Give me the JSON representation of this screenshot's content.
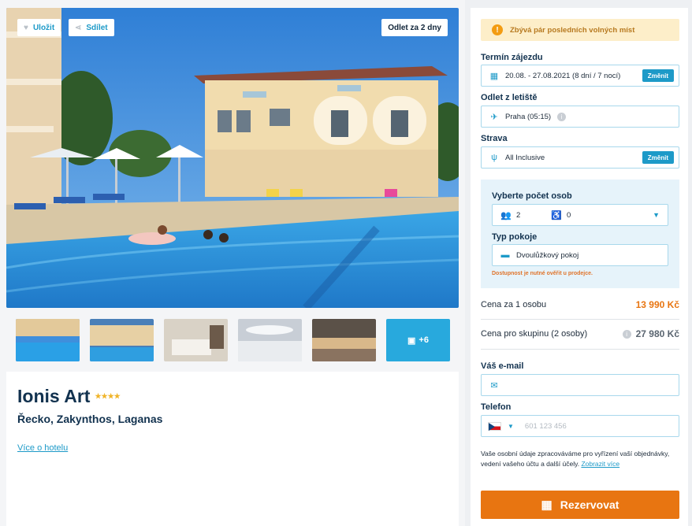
{
  "hero": {
    "save_label": "Uložit",
    "share_label": "Sdílet",
    "departure_badge": "Odlet za 2 dny"
  },
  "thumbnails": {
    "more_label": "+6"
  },
  "hotel": {
    "name": "Ionis Art",
    "stars_text": "★★★★",
    "location": "Řecko, Zakynthos, Laganas",
    "more_link": "Více o hotelu"
  },
  "booking": {
    "warning": "Zbývá pár posledních volných míst",
    "term_label": "Termín zájezdu",
    "term_value": "20.08. - 27.08.2021 (8 dní / 7 nocí)",
    "change_label": "Změnit",
    "airport_label": "Odlet z letiště",
    "airport_value": "Praha (05:15)",
    "board_label": "Strava",
    "board_value": "All Inclusive",
    "persons_label": "Vyberte počet osob",
    "adults": "2",
    "children": "0",
    "room_label": "Typ pokoje",
    "room_value": "Dvoulůžkový pokoj",
    "availability_note": "Dostupnost je nutné ověřit u prodejce.",
    "price_per_person_label": "Cena za 1 osobu",
    "price_per_person": "13 990 Kč",
    "price_group_label": "Cena pro skupinu (2 osoby)",
    "price_group": "27 980 Kč",
    "email_label": "Váš e-mail",
    "email_value": "",
    "phone_label": "Telefon",
    "phone_placeholder": "601 123 456",
    "consent_text": "Vaše osobní údaje zpracováváme pro vyřízení vaší objednávky, vedení vašeho účtu a další účely.",
    "consent_link": "Zobrazit více",
    "book_label": "Rezervovat"
  },
  "colors": {
    "accent": "#1d9ac8",
    "price": "#e87511",
    "warning_bg": "#fdeec9"
  }
}
